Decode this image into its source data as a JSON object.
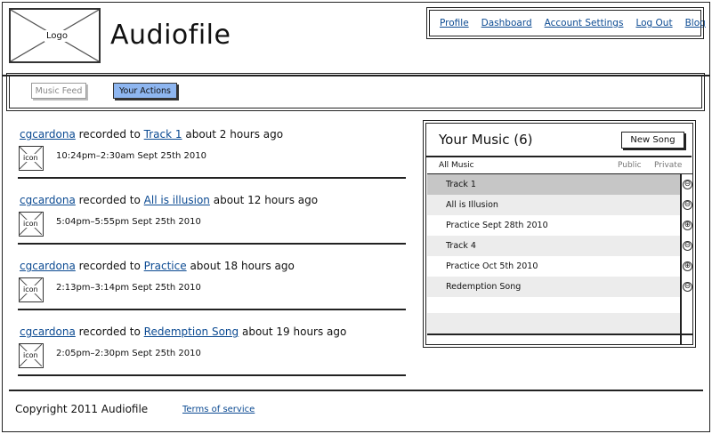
{
  "header": {
    "logo_label": "Logo",
    "app_title": "Audiofile",
    "nav": [
      {
        "label": "Profile"
      },
      {
        "label": "Dashboard"
      },
      {
        "label": "Account Settings"
      },
      {
        "label": "Log Out"
      },
      {
        "label": "Blog"
      }
    ]
  },
  "tabs": {
    "music_feed": "Music Feed",
    "your_actions": "Your Actions",
    "active": "Your Actions"
  },
  "feed": [
    {
      "user": "cgcardona",
      "verb": "recorded to",
      "track": "Track 1",
      "ago": "about 2 hours ago",
      "icon_label": "icon",
      "time": "10:24pm–2:30am Sept 25th 2010"
    },
    {
      "user": "cgcardona",
      "verb": "recorded to",
      "track": "All is illusion",
      "ago": "about 12 hours ago",
      "icon_label": "icon",
      "time": "5:04pm–5:55pm Sept 25th 2010"
    },
    {
      "user": "cgcardona",
      "verb": "recorded to",
      "track": "Practice",
      "ago": "about 18 hours ago",
      "icon_label": "icon",
      "time": "2:13pm–3:14pm Sept 25th 2010"
    },
    {
      "user": "cgcardona",
      "verb": "recorded to",
      "track": "Redemption Song",
      "ago": "about 19 hours ago",
      "icon_label": "icon",
      "time": "2:05pm–2:30pm Sept 25th 2010"
    }
  ],
  "music": {
    "title": "Your Music (6)",
    "new_song_label": "New Song",
    "col_all": "All Music",
    "col_public": "Public",
    "col_private": "Private",
    "songs": [
      {
        "title": "Track 1",
        "toggle": "⊖",
        "selected": true
      },
      {
        "title": "All is Illusion",
        "toggle": "⊖",
        "selected": false
      },
      {
        "title": "Practice Sept 28th 2010",
        "toggle": "⊕",
        "selected": false
      },
      {
        "title": "Track 4",
        "toggle": "⊖",
        "selected": false
      },
      {
        "title": "Practice Oct 5th 2010",
        "toggle": "⊕",
        "selected": false
      },
      {
        "title": "Redemption Song",
        "toggle": "⊖",
        "selected": false
      }
    ]
  },
  "footer": {
    "copyright": "Copyright 2011 Audiofile",
    "terms": "Terms of service"
  },
  "colors": {
    "link": "#0b4a92",
    "active_tab": "#8eb6f0",
    "selected_row": "#c6c6c6",
    "alt_row": "#ececec"
  }
}
